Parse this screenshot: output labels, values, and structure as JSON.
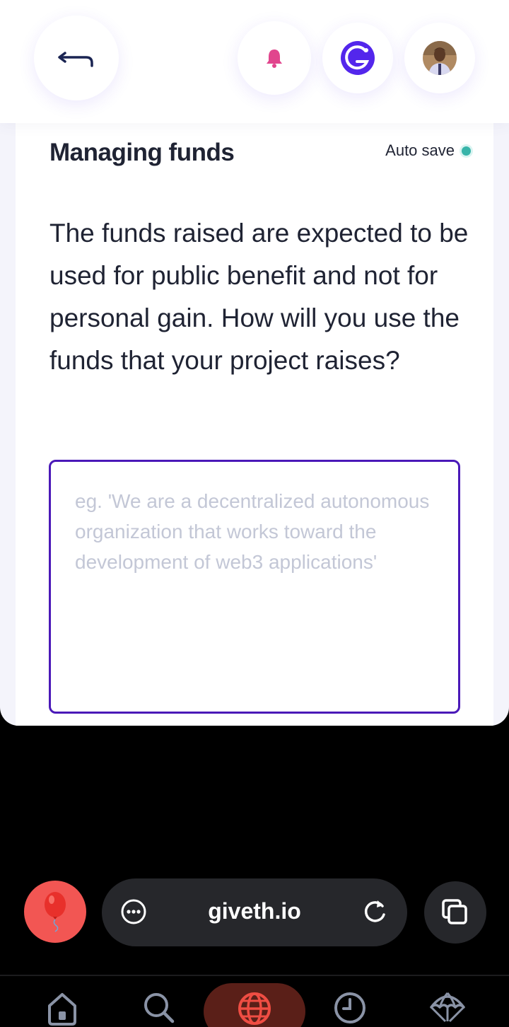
{
  "header": {
    "back_icon": "back-arrow-icon",
    "notification_icon": "bell-icon",
    "logo_icon": "giveth-logo-icon",
    "avatar_icon": "user-avatar"
  },
  "section": {
    "title": "Managing funds",
    "autosave_label": "Auto save",
    "autosave_status_color": "#37b4a9",
    "question": "The funds raised are expected to be used for public benefit and not for personal gain. How will you use the funds that your project raises?",
    "textarea_value": "",
    "textarea_placeholder": "eg. 'We are a decentralized autonomous organization that works toward the development of web3 applications'"
  },
  "browser": {
    "url": "giveth.io",
    "menu_icon": "more-dots-icon",
    "reload_icon": "reload-icon",
    "tabs_icon": "tabs-icon",
    "balloon_icon": "balloon-icon"
  },
  "bottom_nav": {
    "items": [
      "home-icon",
      "search-icon",
      "globe-icon",
      "clock-icon",
      "parachute-icon"
    ],
    "active": "globe-icon"
  },
  "colors": {
    "accent": "#4a19b8",
    "brand_purple": "#5326ec",
    "bell_pink": "#e1458d",
    "balloon_red": "#f25653",
    "active_nav": "#ef4d43"
  }
}
